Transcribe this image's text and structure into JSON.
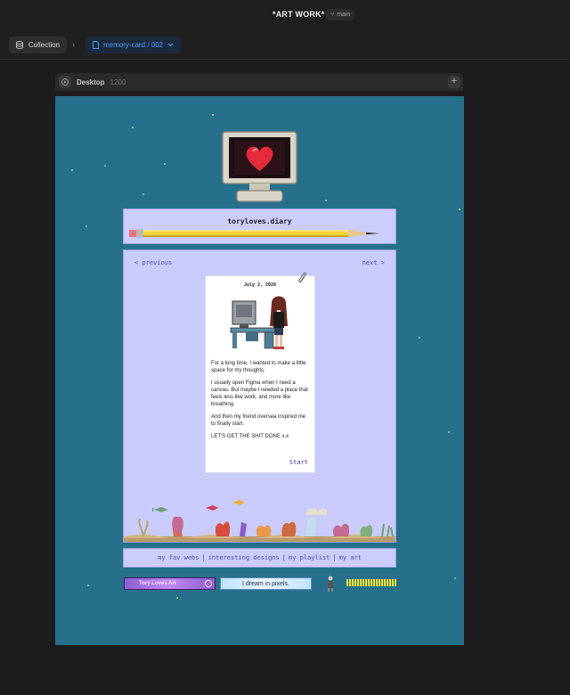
{
  "app": {
    "doc_title": "*ART WORK*",
    "branch": "main"
  },
  "breadcrumb": {
    "collection": "Collection",
    "page": "memory-card / 002"
  },
  "frame": {
    "name": "Desktop",
    "size": "1200"
  },
  "site": {
    "title": "toryloves.diary",
    "nav": {
      "previous": "< previous",
      "next": "next >"
    },
    "card": {
      "date": "July 2, 2026",
      "paragraphs": [
        "For a long time, I wanted to make a little space for my thoughts.",
        "I usually open Figma when I need a canvas. But maybe I needed a place that feels less like work, and more like breathing.",
        "And then my friend oversea inspired me to finally start.",
        "LET'S GET THE SHIT DONE x.x"
      ],
      "start": "Start"
    },
    "links": [
      "my fav webs",
      "interesting designs",
      "my playlist",
      "my art"
    ],
    "badges": {
      "badge1": "Tory Loves Art",
      "badge2": "I dream in pixels."
    }
  },
  "colors": {
    "site_bg": "#26708b",
    "panel_bg": "#c9cbfa",
    "link": "#4a4aaa",
    "accent": "#4d9dff"
  }
}
